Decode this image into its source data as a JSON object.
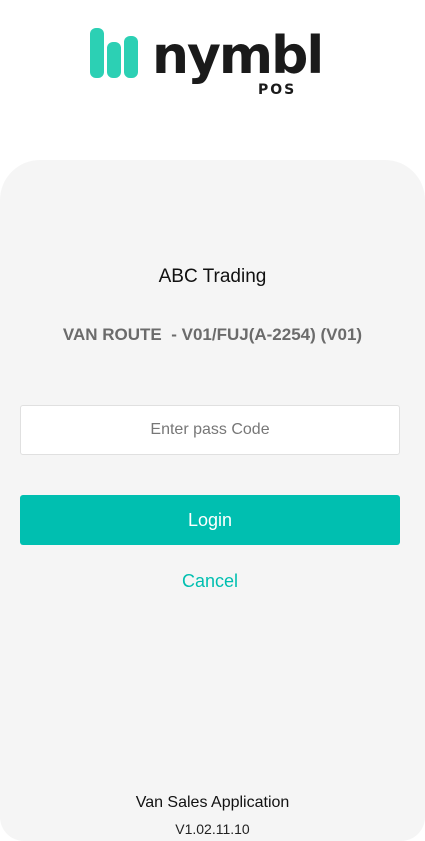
{
  "logo": {
    "wordmark": "nymbl",
    "subtitle": "POS",
    "brand_color": "#2cd0b4"
  },
  "login": {
    "company_name": "ABC Trading",
    "route_text": "VAN ROUTE  - V01/FUJ(A-2254) (V01)",
    "passcode_placeholder": "Enter pass Code",
    "passcode_value": "",
    "login_label": "Login",
    "cancel_label": "Cancel",
    "accent_color": "#00bfb0"
  },
  "footer": {
    "app_name": "Van Sales Application",
    "version": "V1.02.11.10"
  }
}
